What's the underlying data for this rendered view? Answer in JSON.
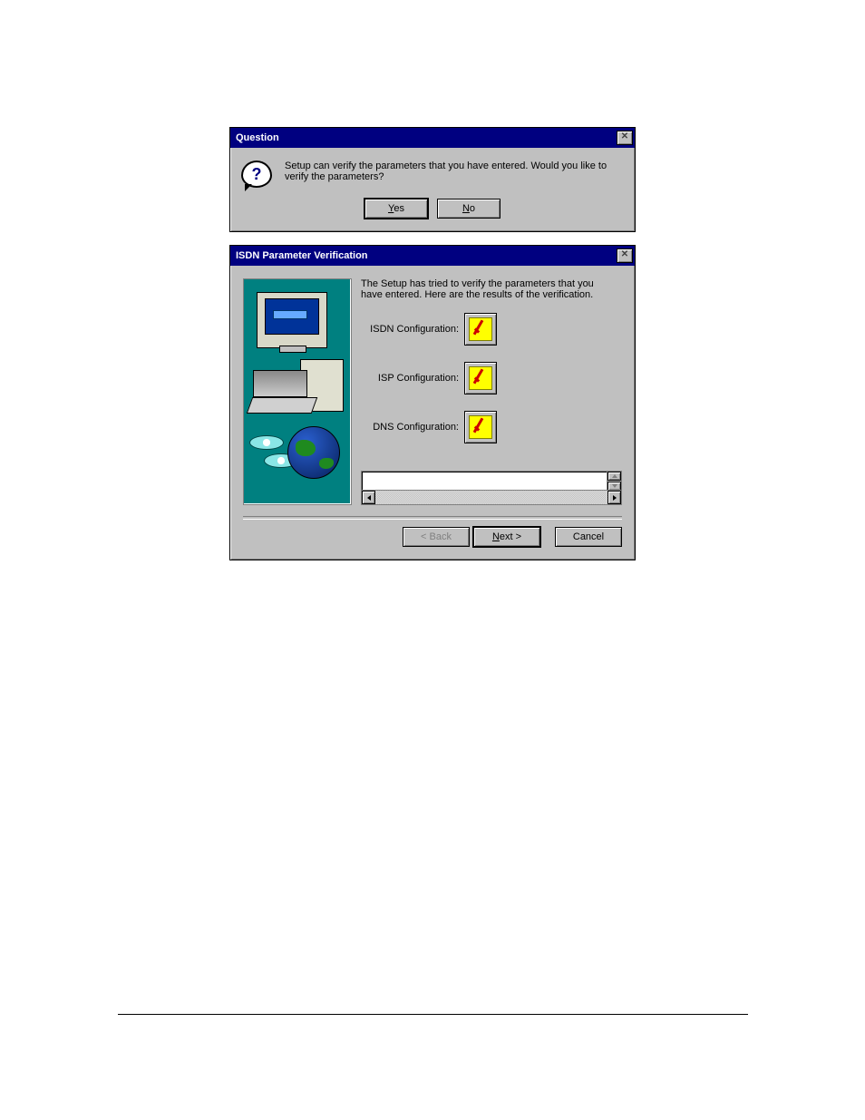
{
  "question_dialog": {
    "title": "Question",
    "message": "Setup can verify the parameters that you have entered. Would you like to verify the parameters?",
    "yes_label": "Yes",
    "no_label": "No"
  },
  "wizard_dialog": {
    "title": "ISDN Parameter Verification",
    "intro": "The Setup has tried to verify the parameters that you have entered. Here are the results of the verification.",
    "rows": {
      "isdn_label": "ISDN Configuration:",
      "isp_label": "ISP Configuration:",
      "dns_label": "DNS Configuration:"
    },
    "buttons": {
      "back": "< Back",
      "next": "Next >",
      "cancel": "Cancel"
    }
  }
}
